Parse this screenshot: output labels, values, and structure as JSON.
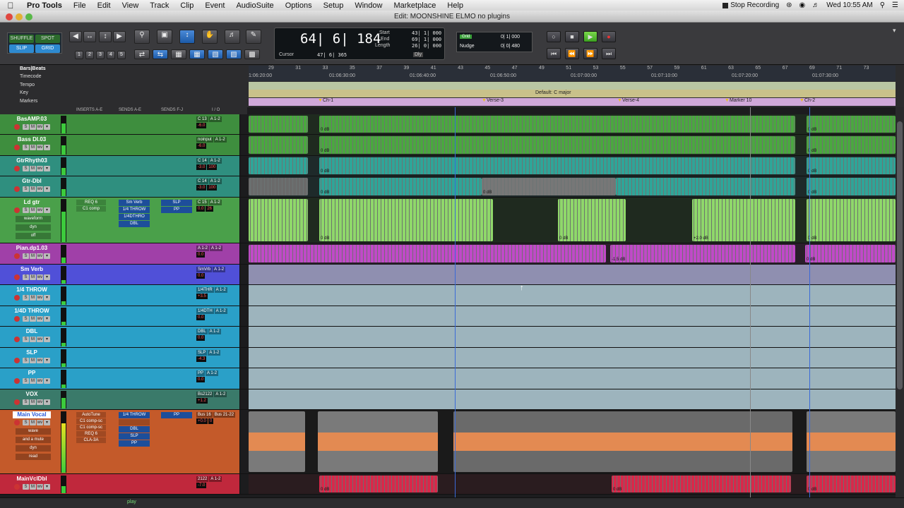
{
  "menubar": {
    "app_name": "Pro Tools",
    "items": [
      "File",
      "Edit",
      "View",
      "Track",
      "Clip",
      "Event",
      "AudioSuite",
      "Options",
      "Setup",
      "Window",
      "Marketplace",
      "Help"
    ],
    "stop_recording": "Stop Recording",
    "clock": "Wed 10:55 AM"
  },
  "window": {
    "title": "Edit: MOONSHINE ELMO no plugins"
  },
  "toolbar": {
    "modes": [
      "SHUFFLE",
      "SPOT",
      "SLIP",
      "GRID"
    ],
    "numbers": [
      "1",
      "2",
      "3",
      "4",
      "5"
    ]
  },
  "counter": {
    "main": "64| 6| 184",
    "cursor_label": "Cursor",
    "cursor_value": "47| 6| 365",
    "start_label": "Start",
    "end_label": "End",
    "length_label": "Length",
    "start": "43| 1| 000",
    "end": "69| 1| 000",
    "length": "26| 0| 000",
    "dly": "Dly"
  },
  "grid": {
    "grid_label": "Grid",
    "grid_value": "0| 1| 000",
    "nudge_label": "Nudge",
    "nudge_value": "0| 0| 480"
  },
  "rulers": {
    "labels": [
      "Bars|Beats",
      "Timecode",
      "Tempo",
      "Key",
      "Markers"
    ],
    "bar_ticks": [
      "29",
      "31",
      "33",
      "35",
      "37",
      "39",
      "41",
      "43",
      "45",
      "47",
      "49",
      "51",
      "53",
      "55",
      "57",
      "59",
      "61",
      "63",
      "65",
      "67",
      "69",
      "71",
      "73"
    ],
    "timecode_ticks": [
      "1:06:20:00",
      "01:06:30:00",
      "01:06:40:00",
      "01:06:50:00",
      "01:07:00:00",
      "01:07:10:00",
      "01:07:20:00",
      "01:07:30:00"
    ],
    "key_label": "Default: C major",
    "markers": [
      {
        "label": "Ch-1"
      },
      {
        "label": "Verse-3"
      },
      {
        "label": "Verse-4"
      },
      {
        "label": "Marker 10"
      },
      {
        "label": "Ch-2"
      }
    ]
  },
  "header_cols": {
    "inserts": "INSERTS A-E",
    "sends": "SENDS A-E",
    "sends2": "SENDS F-J",
    "io": "I / O"
  },
  "tracks": [
    {
      "name": "BasAMP.03",
      "inserts": [],
      "sends": [],
      "io_in": "C 13",
      "io_out": "A 1-2",
      "vol": "-6.0",
      "pan": "",
      "meter": 0.55,
      "color": "#3e8e3e"
    },
    {
      "name": "Bass DI.03",
      "inserts": [],
      "sends": [],
      "io_in": "noinput",
      "io_out": "A 1-2",
      "vol": "-6.0",
      "pan": "",
      "meter": 0.5,
      "color": "#3e8e3e"
    },
    {
      "name": "GtrRhyth03",
      "inserts": [],
      "sends": [],
      "io_in": "C 14",
      "io_out": "A 1-2",
      "vol": "-3.0",
      "pan": "100",
      "meter": 0.4,
      "color": "#2f8f7f"
    },
    {
      "name": "Gtr-Dbl",
      "inserts": [],
      "sends": [],
      "io_in": "C 14",
      "io_out": "A 1-2",
      "vol": "-3.0",
      "pan": "100",
      "meter": 0.4,
      "color": "#2f8f7f"
    },
    {
      "name": "Ld gtr",
      "inserts": [
        "REQ 6",
        "C1 comp"
      ],
      "sends": [
        "Sm Verb",
        "1/4 THROW",
        "1/4DTHRO",
        "DBL"
      ],
      "sends2": [
        "SLP",
        "PP"
      ],
      "io_in": "C 15",
      "io_out": "A 1-2",
      "vol": "0.0",
      "pan": "26",
      "meter": 0.7,
      "color": "#4aa04a",
      "extra": [
        "waveform",
        "dyn",
        "off"
      ]
    },
    {
      "name": "Pian.dp1.03",
      "inserts": [],
      "sends": [],
      "io_in": "A 1-2",
      "io_out": "A 1-2",
      "vol": "0.0",
      "pan": "",
      "meter": 0.3,
      "color": "#a040a8"
    },
    {
      "name": "Sm Verb",
      "inserts": [],
      "sends": [],
      "io_in": "SmVrb",
      "io_out": "A 1-2",
      "vol": "0.0",
      "pan": "",
      "meter": 0.2,
      "color": "#5050d8"
    },
    {
      "name": "1/4 THROW",
      "inserts": [],
      "sends": [],
      "io_in": "1/4THR",
      "io_out": "A 1-2",
      "vol": "+3.5",
      "pan": "",
      "meter": 0.2,
      "color": "#2aa0c8"
    },
    {
      "name": "1/4D THROW",
      "inserts": [],
      "sends": [],
      "io_in": "1/4DTH",
      "io_out": "A 1-2",
      "vol": "0.0",
      "pan": "",
      "meter": 0.2,
      "color": "#2aa0c8"
    },
    {
      "name": "DBL",
      "inserts": [],
      "sends": [],
      "io_in": "DBL",
      "io_out": "A 1-2",
      "vol": "0.0",
      "pan": "",
      "meter": 0.2,
      "color": "#2aa0c8"
    },
    {
      "name": "SLP",
      "inserts": [],
      "sends": [],
      "io_in": "SLP",
      "io_out": "A 1-2",
      "vol": "-4.3",
      "pan": "",
      "meter": 0.2,
      "color": "#2aa0c8"
    },
    {
      "name": "PP",
      "inserts": [],
      "sends": [],
      "io_in": "PP",
      "io_out": "A 1-2",
      "vol": "0.0",
      "pan": "",
      "meter": 0.2,
      "color": "#2aa0c8"
    },
    {
      "name": "VOX",
      "inserts": [],
      "sends": [],
      "io_in": "Bs2122",
      "io_out": "A 1-2",
      "vol": "+1.2",
      "pan": "",
      "meter": 0.6,
      "color": "#3a7a6a"
    },
    {
      "name": "Main Vocal",
      "inserts": [
        "AutoTune",
        "C1 comp-sc",
        "C1 comp-sc",
        "REQ 6",
        "CLA-3A"
      ],
      "sends": [
        "1/4 THROW",
        "",
        "DBL",
        "SLP",
        "PP"
      ],
      "sends2": [
        "PP"
      ],
      "io_in": "Bus 16",
      "io_out": "Bus 21-22",
      "vol": "+0.0",
      "pan": "0",
      "meter": 0.8,
      "color": "#c45a2a",
      "extra": [
        "wave",
        "and a mute",
        "dyn",
        "read"
      ]
    },
    {
      "name": "MainVclDbl",
      "inserts": [],
      "sends": [],
      "io_in": "2122",
      "io_out": "A 1-2",
      "vol": "-7.0",
      "pan": "",
      "meter": 0.4,
      "color": "#c0283c"
    }
  ],
  "clip_db": {
    "zero": "0 dB",
    "plus2": "+2.0 dB",
    "minus15": "-1.5 dB"
  },
  "status": {
    "play": "play"
  }
}
